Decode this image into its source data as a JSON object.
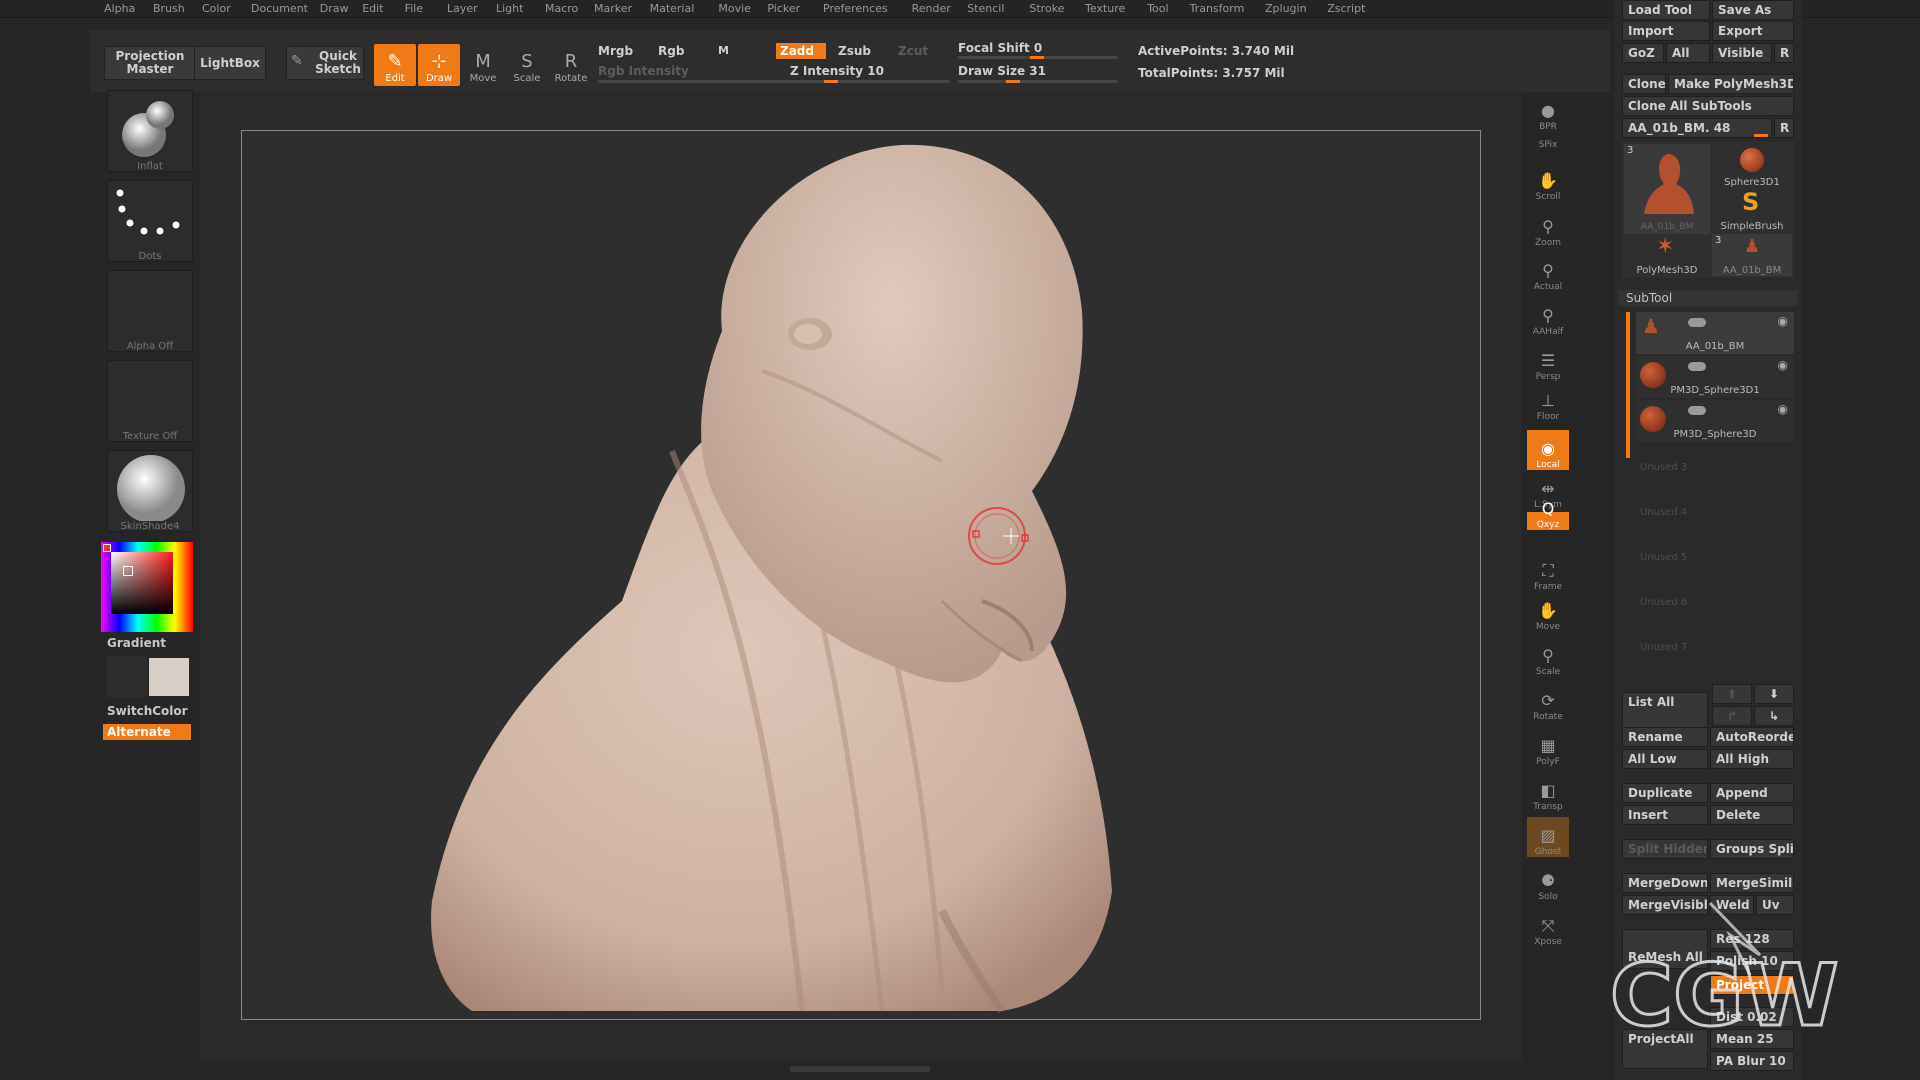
{
  "menu": [
    "Alpha",
    "Brush",
    "Color",
    "Document",
    "Draw",
    "Edit",
    "File",
    "Layer",
    "Light",
    "Macro",
    "Marker",
    "Material",
    "Movie",
    "Picker",
    "Preferences",
    "Render",
    "Stencil",
    "Stroke",
    "Texture",
    "Tool",
    "Transform",
    "Zplugin",
    "Zscript"
  ],
  "topshelf": {
    "projection_master": "Projection\nMaster",
    "lightbox": "LightBox",
    "quick_sketch": "Quick\nSketch",
    "tools": [
      {
        "label": "Edit",
        "active": true
      },
      {
        "label": "Draw",
        "active": true
      },
      {
        "label": "Move",
        "active": false
      },
      {
        "label": "Scale",
        "active": false
      },
      {
        "label": "Rotate",
        "active": false
      }
    ],
    "mrgb": "Mrgb",
    "rgb": "Rgb",
    "m": "M",
    "rgb_intensity": "Rgb  Intensity",
    "zadd": "Zadd",
    "zsub": "Zsub",
    "zcut": "Zcut",
    "z_intensity": "Z  Intensity 10",
    "focal_shift": "Focal  Shift 0",
    "draw_size": "Draw  Size 31",
    "active_points": "ActivePoints: 3.740  Mil",
    "total_points": "TotalPoints: 3.757  Mil"
  },
  "leftshelf": {
    "brush": "Inflat",
    "stroke": "Dots",
    "alpha": "Alpha  Off",
    "texture": "Texture  Off",
    "material": "SkinShade4",
    "gradient": "Gradient",
    "switchcolor": "SwitchColor",
    "alternate": "Alternate",
    "main_color": "#ff2a2a",
    "secondary_color": "#d8d0c6"
  },
  "rightbar": [
    "BPR",
    "SPix",
    "Scroll",
    "Zoom",
    "Actual",
    "AAHalf",
    "Persp",
    "Floor",
    "Local",
    "L.Sym",
    "Qxyz",
    "Frame",
    "Move",
    "Scale",
    "Rotate",
    "PolyF",
    "Transp",
    "Ghost",
    "Solo",
    "Xpose"
  ],
  "toolpanel": {
    "load_tool": "Load  Tool",
    "save_as": "Save  As",
    "import": "Import",
    "export": "Export",
    "goz": "GoZ",
    "all": "All",
    "visible": "Visible",
    "r": "R",
    "clone": "Clone",
    "make_polymesh": "Make  PolyMesh3D",
    "clone_all": "Clone  All  SubTools",
    "current_tool": "AA_01b_BM. 48",
    "tool_thumbs": [
      "AA_01b_BM",
      "Sphere3D1",
      "SimpleBrush",
      "PolyMesh3D",
      "AA_01b_BM"
    ],
    "thumb_count_1": "3",
    "thumb_count_2": "3",
    "subtool_header": "SubTool",
    "subtools": [
      "AA_01b_BM",
      "PM3D_Sphere3D1",
      "PM3D_Sphere3D"
    ],
    "unused": [
      "Unused  3",
      "Unused  4",
      "Unused  5",
      "Unused  6",
      "Unused  7"
    ],
    "list_all": "List  All",
    "rename": "Rename",
    "autoreorder": "AutoReorder",
    "all_low": "All  Low",
    "all_high": "All  High",
    "duplicate": "Duplicate",
    "append": "Append",
    "insert": "Insert",
    "delete": "Delete",
    "split_hidden": "Split  Hidden",
    "groups_split": "Groups  Split",
    "mergedown": "MergeDown",
    "mergesimilar": "MergeSimilar",
    "mergevisible": "MergeVisible",
    "weld": "Weld",
    "uv": "Uv",
    "res": "Res 128",
    "remesh_all": "ReMesh  All",
    "polish": "Polish 10",
    "project": "Project",
    "dist": "Dist 0.02",
    "projectall": "ProjectAll",
    "mean": "Mean 25",
    "pa_blur": "PA  Blur 10"
  },
  "watermark": "CGW",
  "colors": {
    "accent": "#f07a16",
    "model": "#d9c2b4",
    "canvas": "#2e2e2e"
  }
}
